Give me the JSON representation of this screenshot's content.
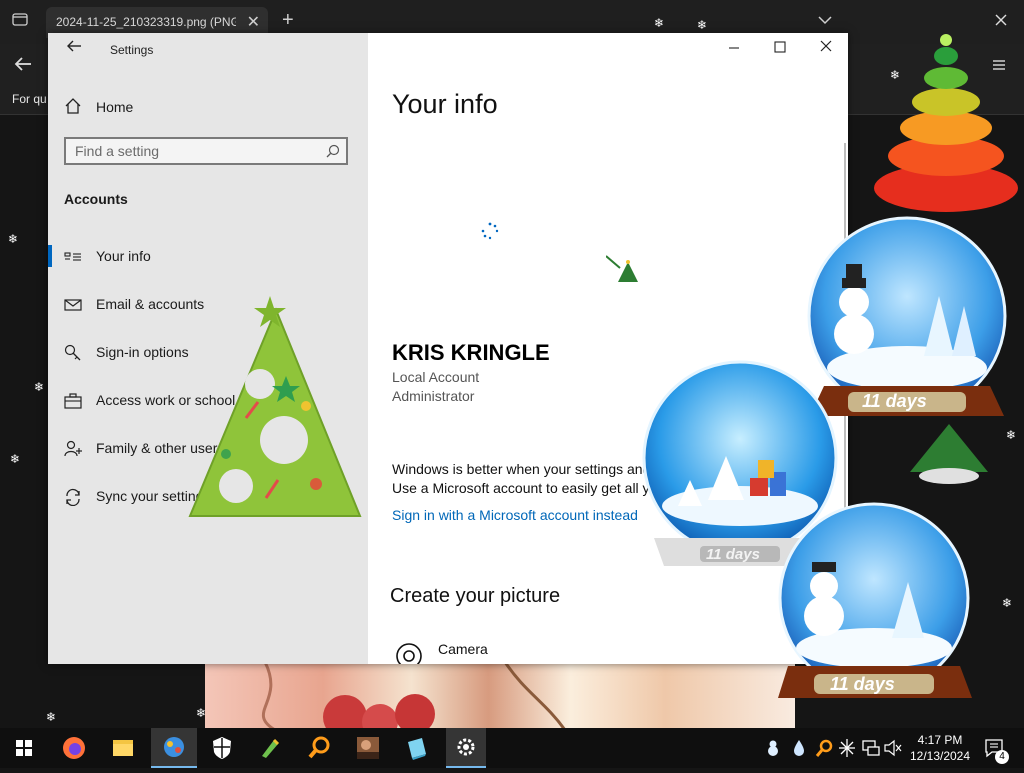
{
  "browser": {
    "tab_title": "2024-11-25_210323319.png (PNG In",
    "tab_close": "✕",
    "new_tab": "+",
    "caption": "For qu"
  },
  "settings": {
    "window_title": "Settings",
    "nav": {
      "home": "Home",
      "search_placeholder": "Find a setting",
      "section": "Accounts",
      "items": [
        {
          "label": "Your info",
          "icon": "person-card-icon",
          "active": true
        },
        {
          "label": "Email & accounts",
          "icon": "mail-icon"
        },
        {
          "label": "Sign-in options",
          "icon": "key-icon"
        },
        {
          "label": "Access work or school",
          "icon": "briefcase-icon"
        },
        {
          "label": "Family & other users",
          "icon": "person-add-icon"
        },
        {
          "label": "Sync your settings",
          "icon": "sync-icon"
        }
      ]
    },
    "content": {
      "title": "Your info",
      "user_name": "KRIS KRINGLE",
      "account_type": "Local Account",
      "account_role": "Administrator",
      "message_line1": "Windows is better when your settings and",
      "message_line2": "Use a Microsoft account to easily get all y",
      "signin_link": "Sign in with a Microsoft account instead",
      "create_picture_title": "Create your picture",
      "camera_label": "Camera"
    }
  },
  "decorations": {
    "globe_labels": [
      "11 days",
      "11 days",
      "11 days"
    ]
  },
  "taskbar": {
    "apps": [
      "start",
      "firefox",
      "file-explorer",
      "app-blue",
      "defender",
      "app-green",
      "search-orange",
      "photo",
      "app-cyan",
      "settings"
    ],
    "time": "4:17 PM",
    "date": "12/13/2024",
    "notification_count": "4"
  },
  "colors": {
    "accent": "#0067c0",
    "link": "#0067b8",
    "nav_bg": "#e6e6e6",
    "taskbar": "#0f0f0f"
  }
}
